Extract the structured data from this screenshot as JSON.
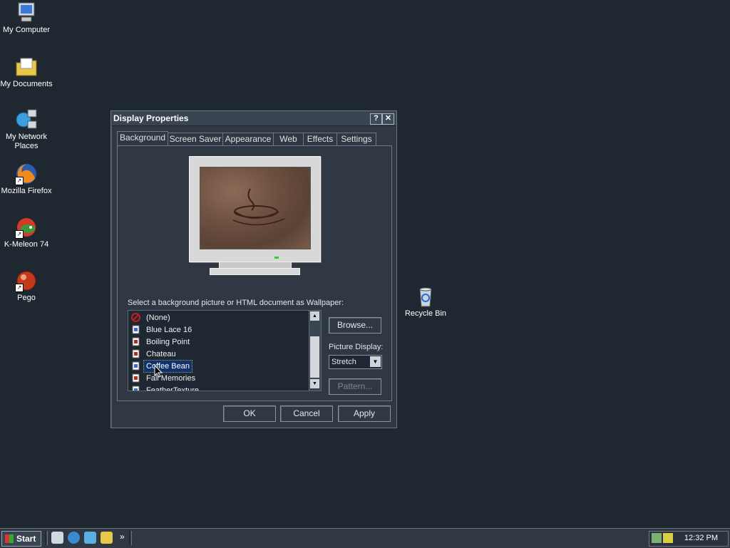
{
  "desktop": {
    "icons": [
      {
        "label": "My Computer",
        "icon": "computer-icon"
      },
      {
        "label": "My Documents",
        "icon": "folder-documents-icon"
      },
      {
        "label": "My Network Places",
        "icon": "network-icon"
      },
      {
        "label": "Mozilla Firefox",
        "icon": "firefox-icon"
      },
      {
        "label": "K-Meleon 74",
        "icon": "kmeleon-icon"
      },
      {
        "label": "Pego",
        "icon": "pego-icon"
      },
      {
        "label": "Recycle Bin",
        "icon": "recycle-bin-icon"
      }
    ]
  },
  "dialog": {
    "title": "Display Properties",
    "help_label": "?",
    "close_label": "✕",
    "tabs": [
      "Background",
      "Screen Saver",
      "Appearance",
      "Web",
      "Effects",
      "Settings"
    ],
    "active_tab": "Background",
    "wallpaper_label": "Select a background picture or HTML document as Wallpaper:",
    "wallpapers": [
      {
        "label": "(None)",
        "icon": "none-icon"
      },
      {
        "label": "Blue Lace 16",
        "icon": "bmp-file-icon"
      },
      {
        "label": "Boiling Point",
        "icon": "image-file-icon"
      },
      {
        "label": "Chateau",
        "icon": "image-file-icon"
      },
      {
        "label": "Coffee Bean",
        "icon": "bmp-file-icon",
        "selected": true
      },
      {
        "label": "Fall Memories",
        "icon": "image-file-icon"
      },
      {
        "label": "FeatherTexture",
        "icon": "bmp-file-icon"
      }
    ],
    "browse_label": "Browse...",
    "picture_display_label": "Picture Display:",
    "picture_display_value": "Stretch",
    "pattern_label": "Pattern...",
    "ok_label": "OK",
    "cancel_label": "Cancel",
    "apply_label": "Apply"
  },
  "taskbar": {
    "start_label": "Start",
    "clock": "12:32 PM",
    "more_label": "»"
  },
  "colors": {
    "desktop_bg": "#1f2730",
    "dialog_bg": "#2f3843",
    "selection": "#12326a"
  }
}
